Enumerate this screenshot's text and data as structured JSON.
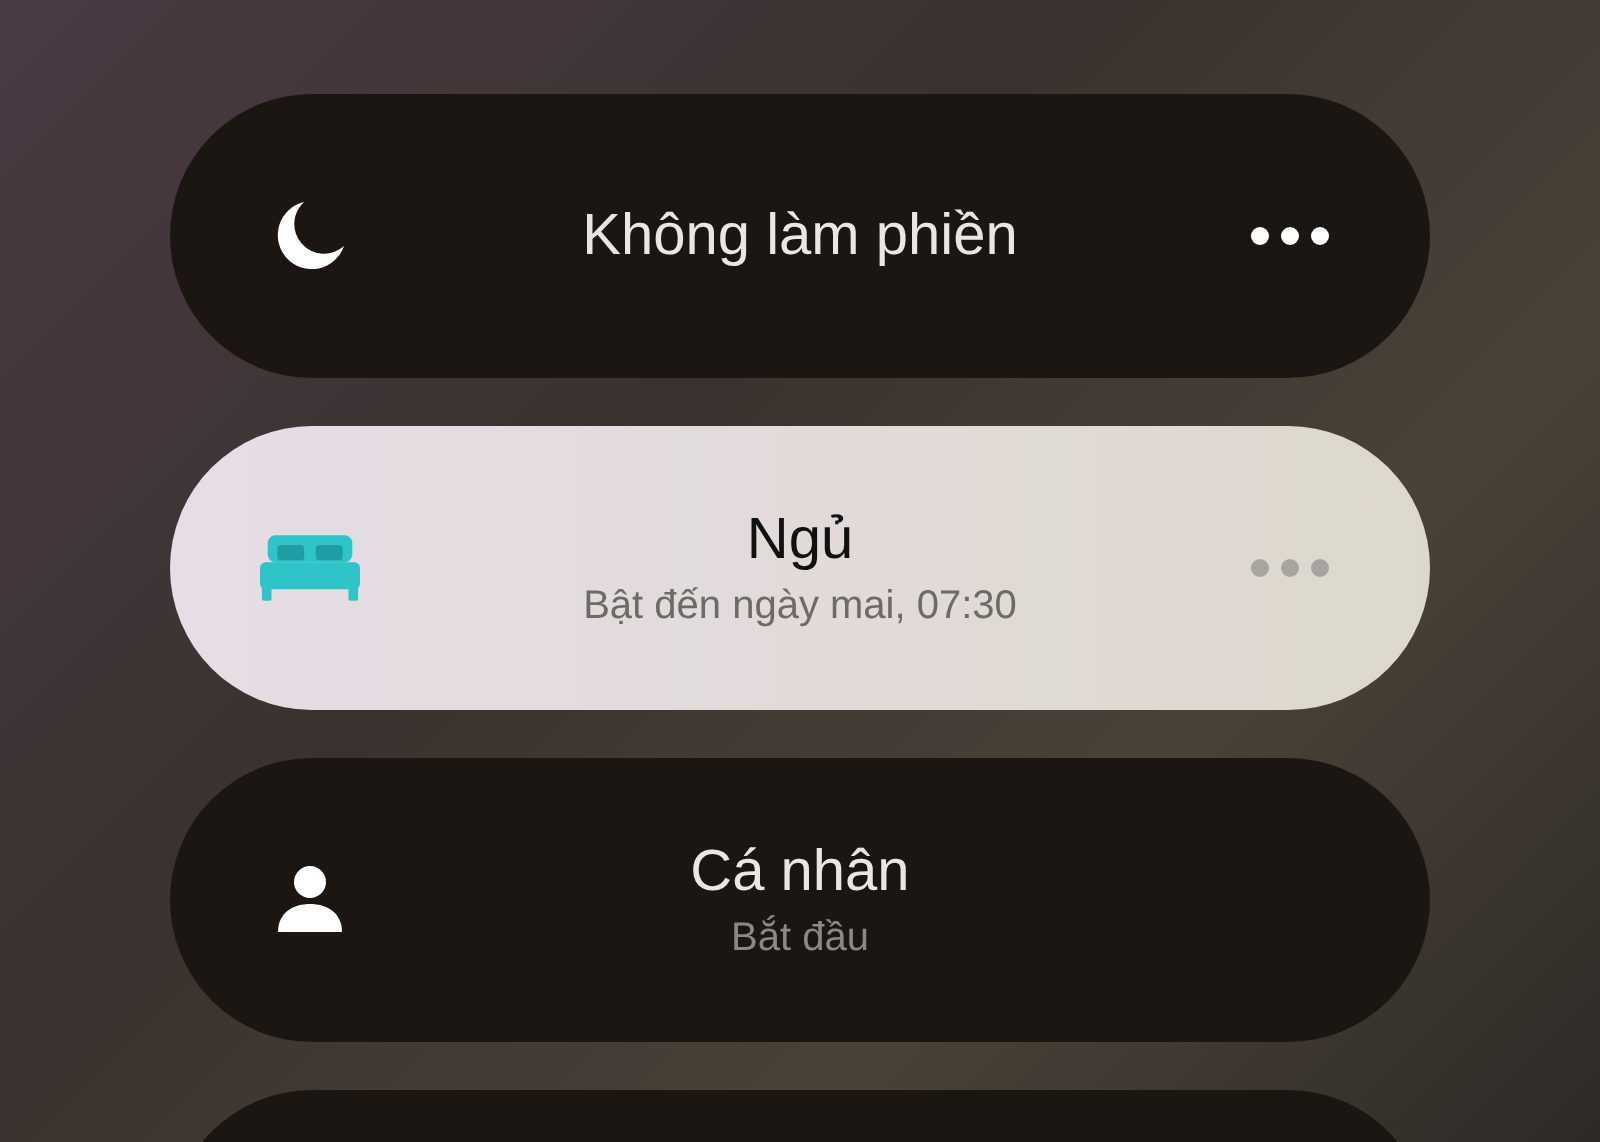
{
  "focus_modes": [
    {
      "kind": "moon",
      "title": "Không làm phiền",
      "selected": false,
      "more": true
    },
    {
      "kind": "bed",
      "title": "Ngủ",
      "subtitle": "Bật đến ngày mai, 07:30",
      "selected": true,
      "more": true
    },
    {
      "kind": "person",
      "title": "Cá nhân",
      "subtitle": "Bắt đầu",
      "selected": false,
      "more": false
    }
  ]
}
